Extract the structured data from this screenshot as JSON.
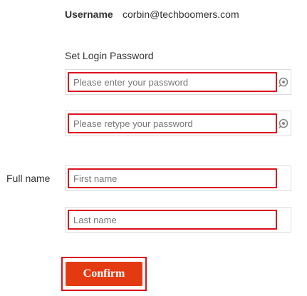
{
  "account": {
    "username_label": "Username",
    "username_value": "corbin@techboomers.com"
  },
  "password_section": {
    "heading": "Set Login Password",
    "password_placeholder": "Please enter your password",
    "retype_placeholder": "Please retype your password",
    "toggle_icon": "eye-toggle-icon"
  },
  "full_name": {
    "label": "Full name",
    "first_placeholder": "First name",
    "last_placeholder": "Last name"
  },
  "confirm": {
    "label": "Confirm"
  },
  "colors": {
    "accent": "#d9131e",
    "button": "#e43a12"
  }
}
